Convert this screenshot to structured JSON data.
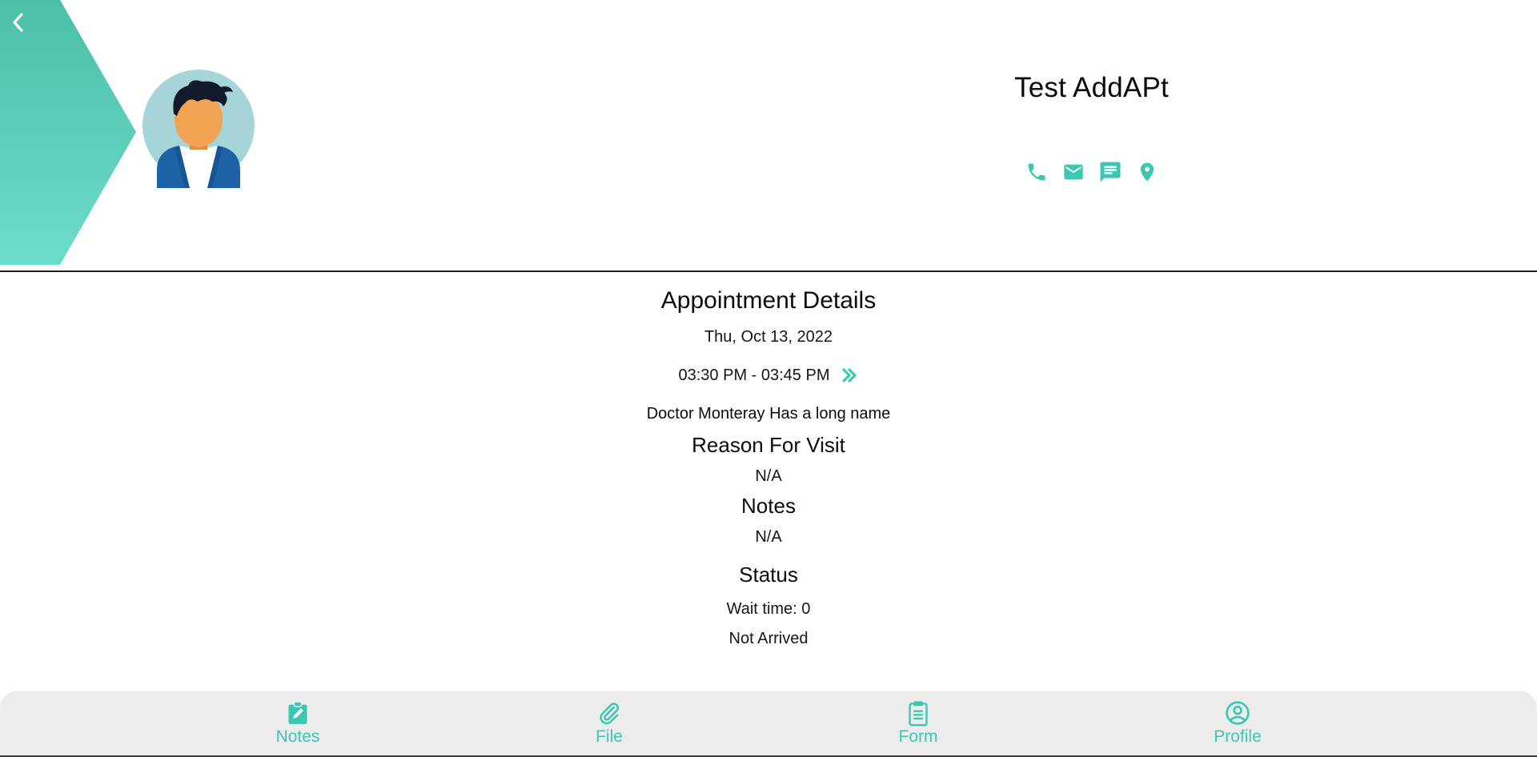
{
  "header": {
    "patient_name": "Test AddAPt",
    "accent_color": "#3cc7b3",
    "banner_gradient": [
      "#4cbfa8",
      "#6ddccb"
    ],
    "icons": {
      "back": "chevron-left-icon",
      "contacts": [
        "phone-icon",
        "email-icon",
        "message-icon",
        "location-icon"
      ]
    }
  },
  "appointment": {
    "title": "Appointment Details",
    "date": "Thu, Oct 13, 2022",
    "time": "03:30 PM - 03:45 PM",
    "doctor": "Doctor Monteray Has a long name",
    "reason_title": "Reason For Visit",
    "reason_value": "N/A",
    "notes_title": "Notes",
    "notes_value": "N/A",
    "status_title": "Status",
    "wait_time": "Wait time: 0",
    "status_value": "Not Arrived"
  },
  "bottom_nav": {
    "items": [
      {
        "label": "Notes",
        "icon": "clipboard-edit-icon"
      },
      {
        "label": "File",
        "icon": "paperclip-icon"
      },
      {
        "label": "Form",
        "icon": "clipboard-list-icon"
      },
      {
        "label": "Profile",
        "icon": "profile-circle-icon"
      }
    ]
  }
}
